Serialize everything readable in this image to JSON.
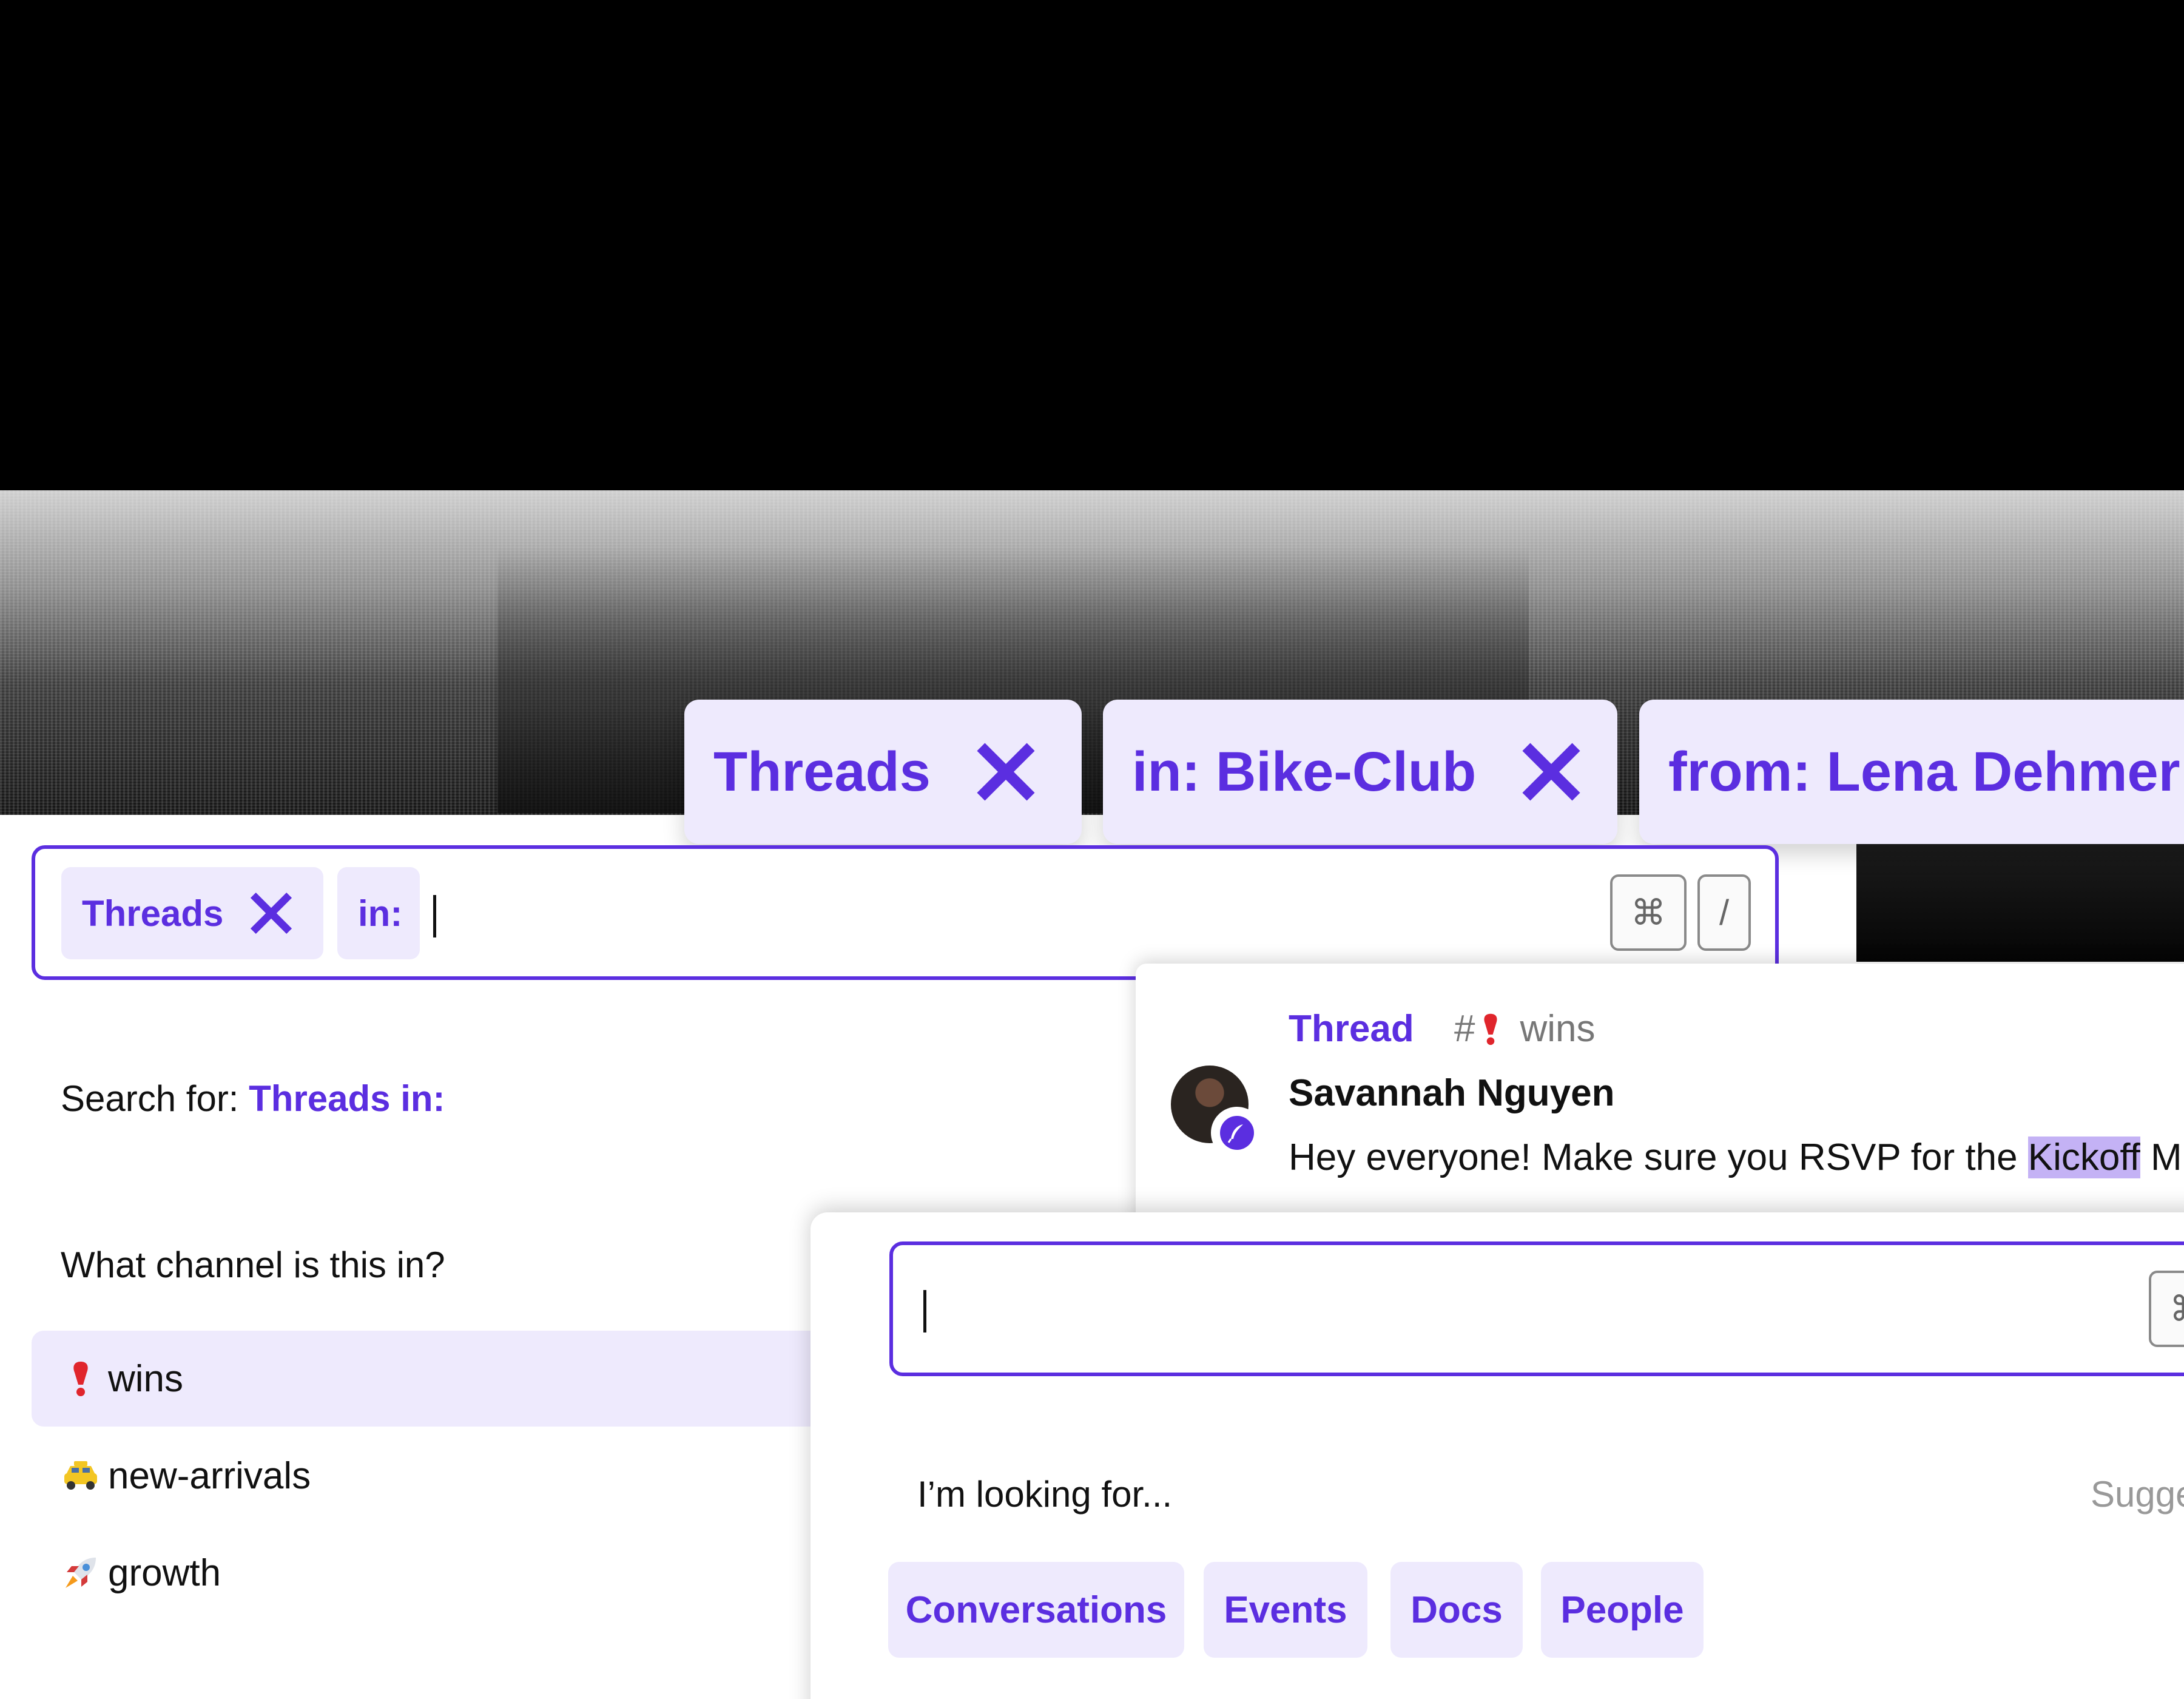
{
  "floating_filters": [
    {
      "label": "Threads"
    },
    {
      "label": "in: Bike-Club"
    },
    {
      "label": "from: Lena Dehmer"
    }
  ],
  "search_bar": {
    "chips": [
      {
        "label": "Threads"
      },
      {
        "label": "in:"
      }
    ],
    "shortcut_keys": [
      "⌘",
      "/"
    ]
  },
  "left_panel": {
    "search_for_prefix": "Search for:",
    "search_for_query": "Threads in:",
    "question": "What channel is this in?",
    "channels": [
      {
        "name": "wins",
        "icon": "exclamation-icon",
        "selected": true
      },
      {
        "name": "new-arrivals",
        "icon": "taxi-icon",
        "selected": false
      },
      {
        "name": "growth",
        "icon": "rocket-icon",
        "selected": false
      }
    ]
  },
  "thread_result": {
    "type_label": "Thread",
    "channel_hash": "#",
    "channel_name": "wins",
    "author": "Savannah Nguyen",
    "message_before": "Hey everyone! Make sure you RSVP for the ",
    "message_highlight": "Kickoff",
    "message_after": " M"
  },
  "search_panel_2": {
    "shortcut_key": "⌘",
    "looking_for": "I’m looking for...",
    "suggest_label": "Sugge",
    "categories": [
      {
        "label": "Conversations"
      },
      {
        "label": "Events"
      },
      {
        "label": "Docs"
      },
      {
        "label": "People"
      }
    ]
  },
  "colors": {
    "accent": "#5b2ee0",
    "chip_bg": "#eeeafd",
    "highlight": "#c4b2f5"
  }
}
